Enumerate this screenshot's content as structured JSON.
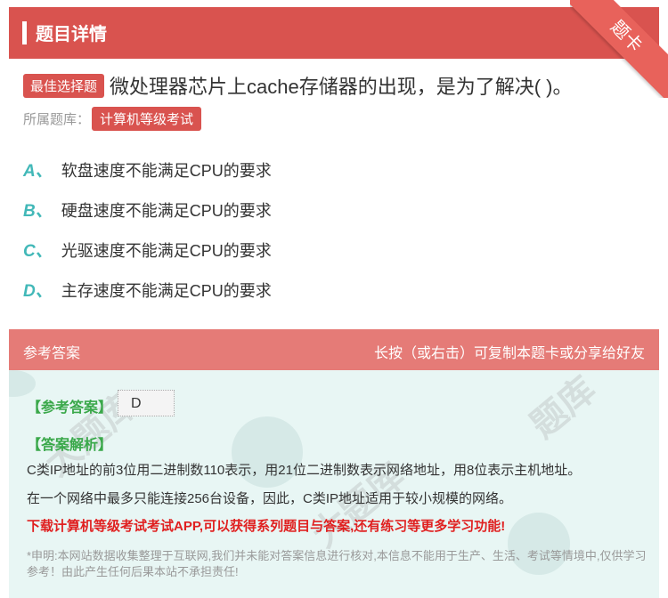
{
  "header": {
    "title": "题目详情",
    "corner_label": "题卡"
  },
  "question": {
    "badge": "最佳选择题",
    "text": "微处理器芯片上cache存储器的出现，是为了解决( )。"
  },
  "source": {
    "label": "所属题库：",
    "tag": "计算机等级考试"
  },
  "options": [
    {
      "letter": "A、",
      "text": "软盘速度不能满足CPU的要求"
    },
    {
      "letter": "B、",
      "text": "硬盘速度不能满足CPU的要求"
    },
    {
      "letter": "C、",
      "text": "光驱速度不能满足CPU的要求"
    },
    {
      "letter": "D、",
      "text": "主存速度不能满足CPU的要求"
    }
  ],
  "answer_section": {
    "title": "参考答案",
    "hint": "长按（或右击）可复制本题卡或分享给好友",
    "ref_label": "【参考答案】",
    "ref_answer": "D",
    "analysis_label": "【答案解析】",
    "analysis_lines": [
      "C类IP地址的前3位用二进制数110表示，用21位二进制数表示网络地址，用8位表示主机地址。",
      "在一个网络中最多只能连接256台设备，因此，C类IP地址适用于较小规模的网络。"
    ],
    "promo": "下载计算机等级考试考试APP,可以获得系列题目与答案,还有练习等更多学习功能!",
    "disclaimer": "*申明:本网站数据收集整理于互联网,我们并未能对答案信息进行核对,本信息不能用于生产、生活、考试等情境中,仅供学习参考！由此产生任何后果本站不承担责任!"
  },
  "colors": {
    "accent": "#d9534f",
    "option_letter": "#42b8b8",
    "green": "#3aa84a",
    "promo": "#e02020"
  }
}
